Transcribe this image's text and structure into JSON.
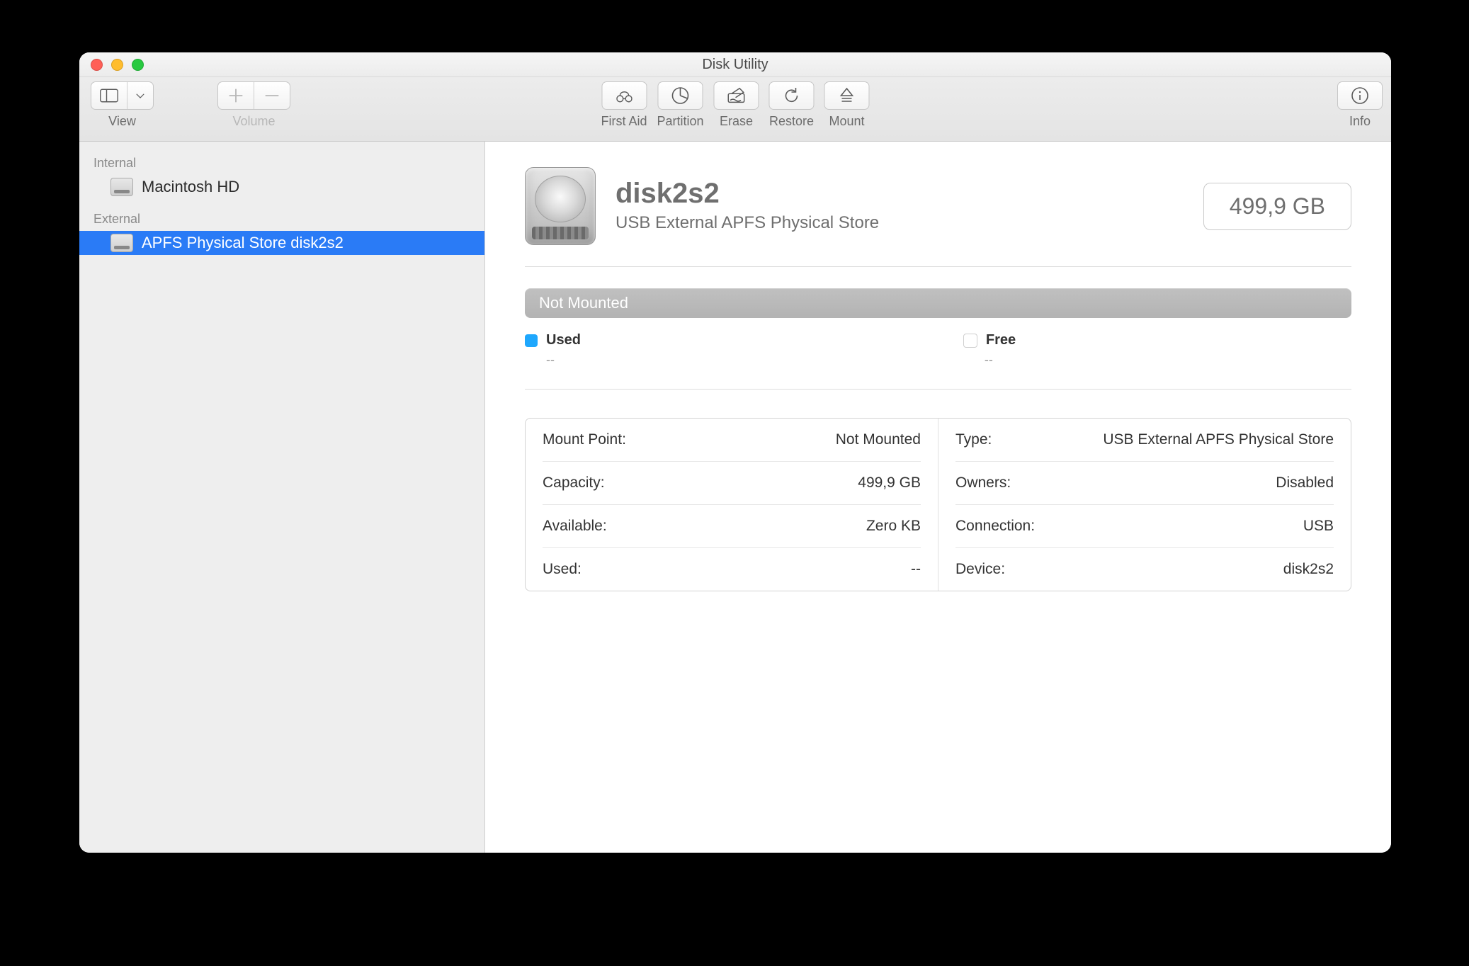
{
  "window": {
    "title": "Disk Utility"
  },
  "toolbar": {
    "view_label": "View",
    "volume_label": "Volume",
    "first_aid_label": "First Aid",
    "partition_label": "Partition",
    "erase_label": "Erase",
    "restore_label": "Restore",
    "mount_label": "Mount",
    "info_label": "Info"
  },
  "sidebar": {
    "internal_label": "Internal",
    "external_label": "External",
    "internal_item": "Macintosh HD",
    "external_item": "APFS Physical Store disk2s2"
  },
  "main": {
    "title": "disk2s2",
    "subtitle": "USB External APFS Physical Store",
    "capacity_badge": "499,9 GB",
    "mount_status": "Not Mounted",
    "legend": {
      "used_label": "Used",
      "used_value": "--",
      "free_label": "Free",
      "free_value": "--"
    },
    "details": {
      "left": [
        {
          "k": "Mount Point:",
          "v": "Not Mounted"
        },
        {
          "k": "Capacity:",
          "v": "499,9 GB"
        },
        {
          "k": "Available:",
          "v": "Zero KB"
        },
        {
          "k": "Used:",
          "v": "--"
        }
      ],
      "right": [
        {
          "k": "Type:",
          "v": "USB External APFS Physical Store"
        },
        {
          "k": "Owners:",
          "v": "Disabled"
        },
        {
          "k": "Connection:",
          "v": "USB"
        },
        {
          "k": "Device:",
          "v": "disk2s2"
        }
      ]
    }
  }
}
